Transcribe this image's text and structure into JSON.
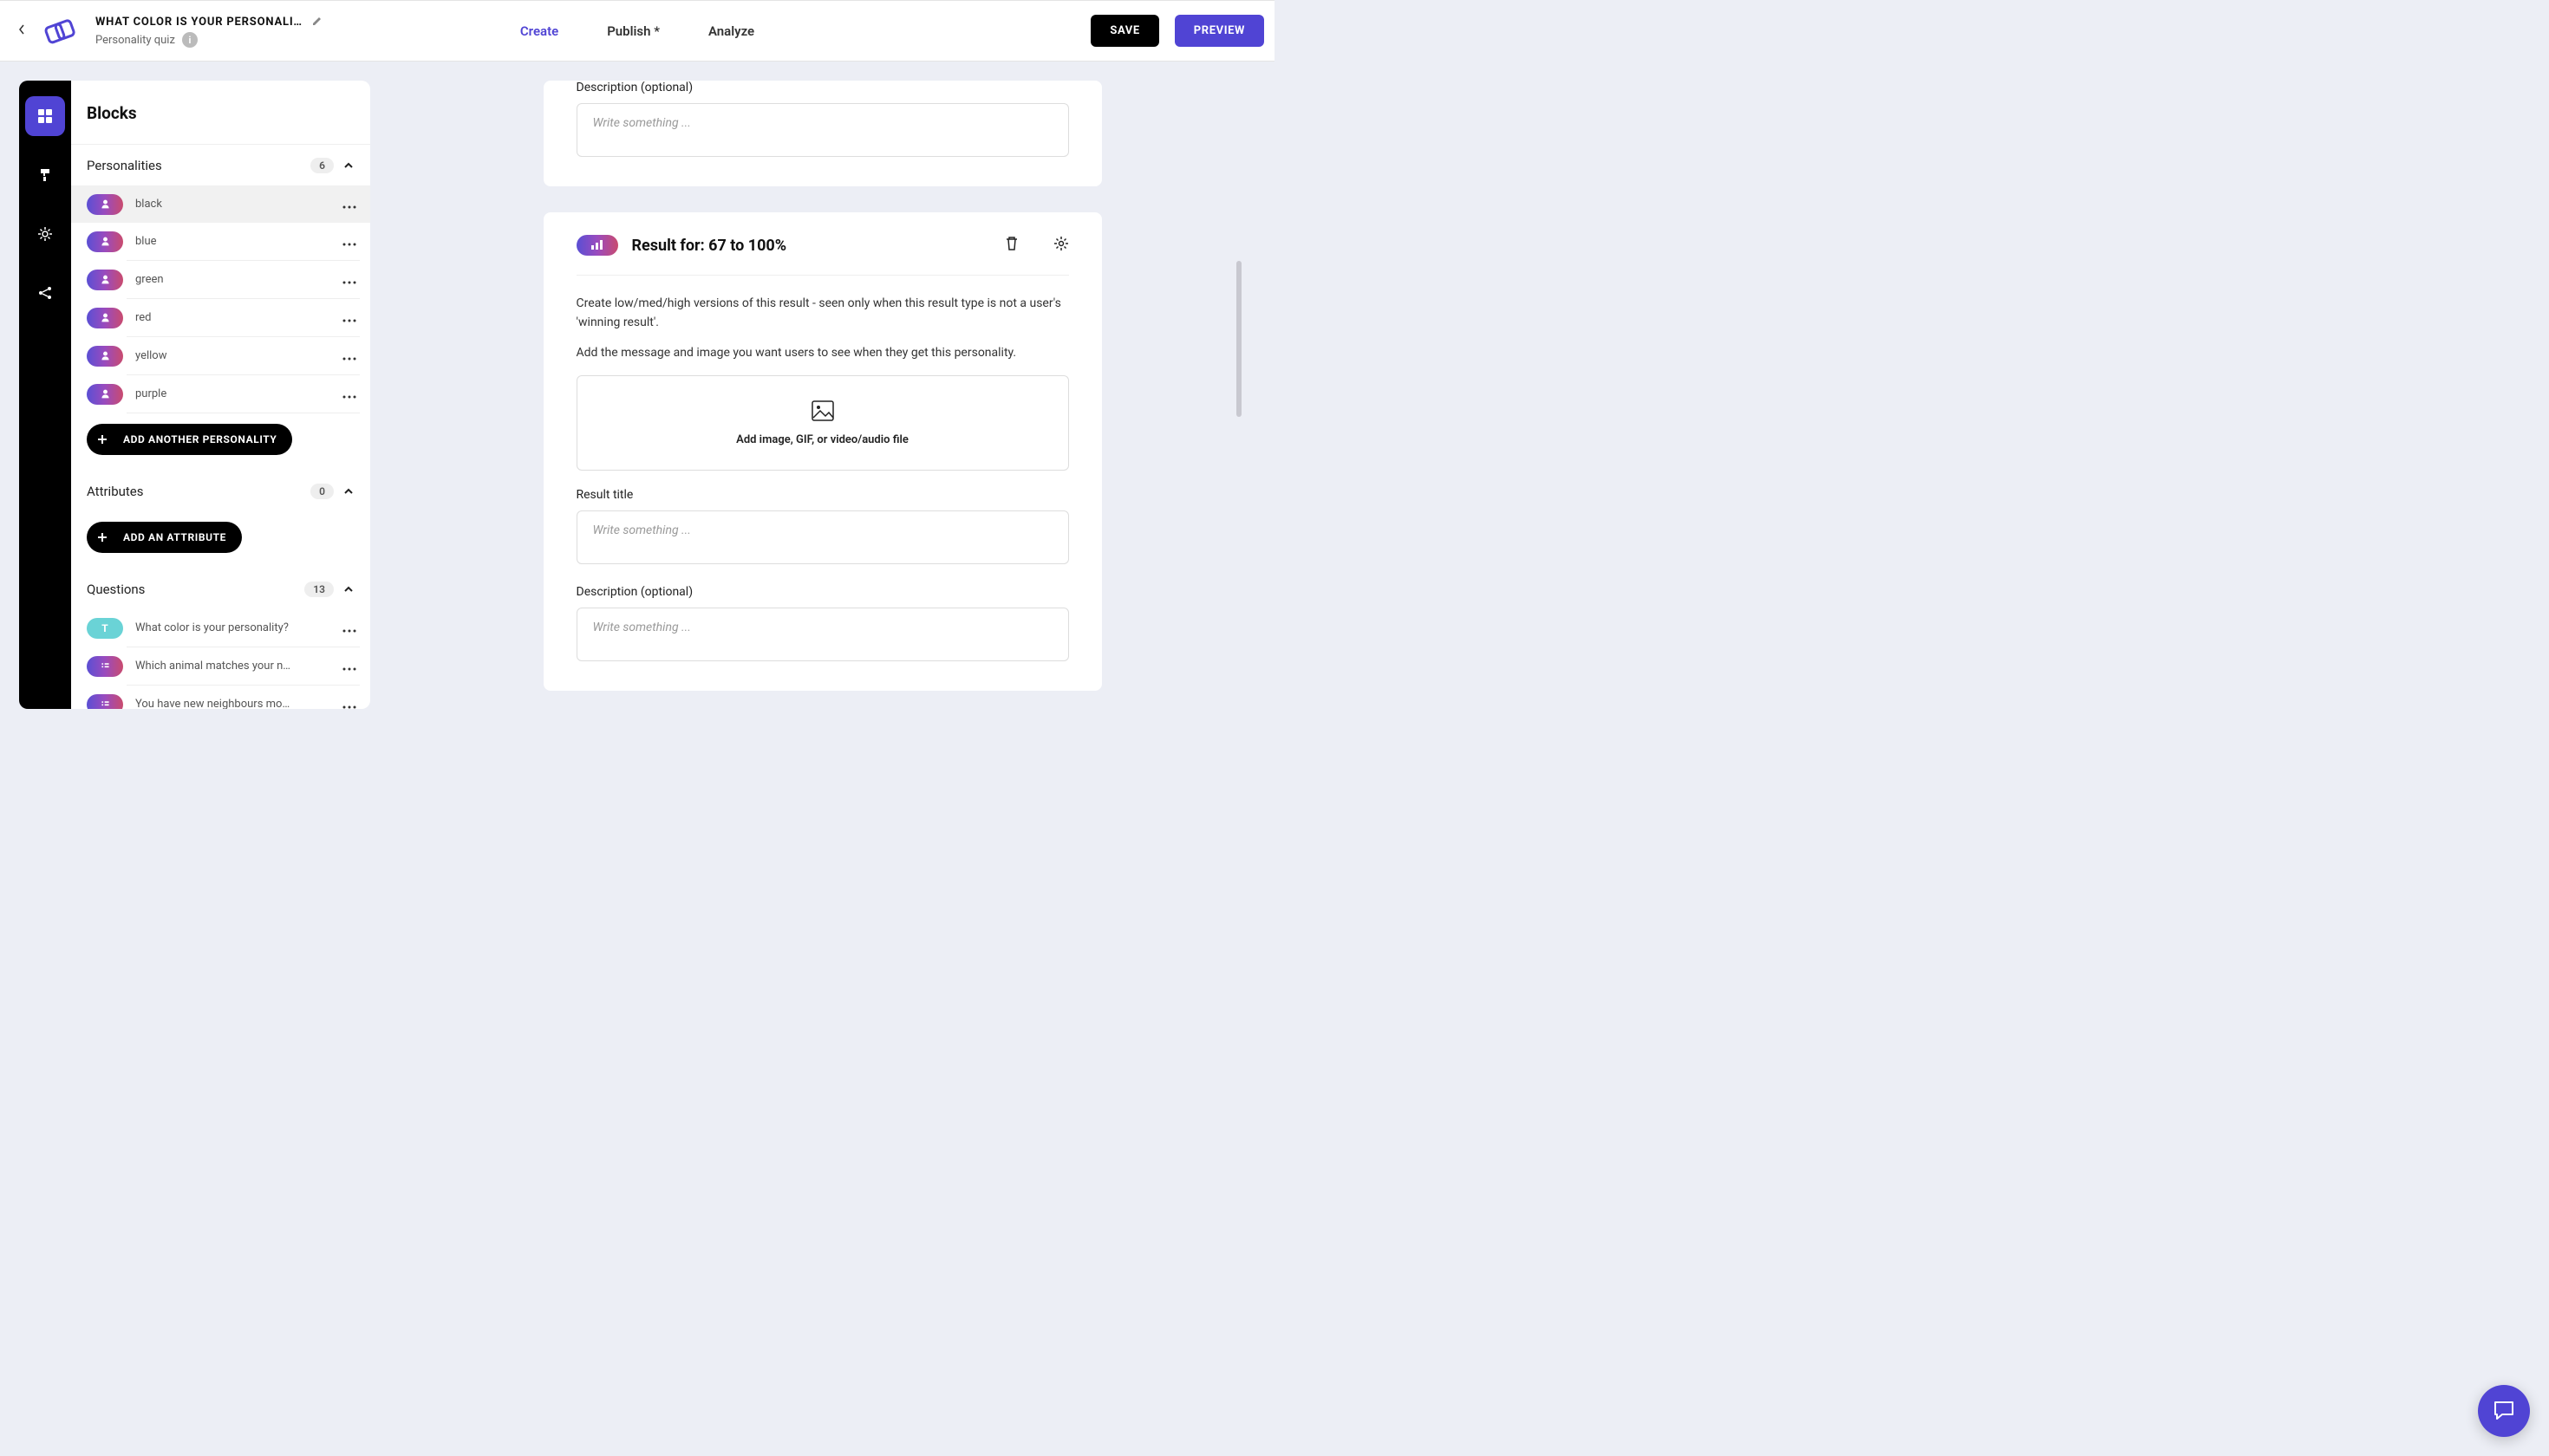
{
  "header": {
    "title": "WHAT COLOR IS YOUR PERSONALI…",
    "subtitle": "Personality quiz",
    "nav": {
      "create": "Create",
      "publish": "Publish *",
      "analyze": "Analyze"
    },
    "save": "SAVE",
    "preview": "PREVIEW"
  },
  "sidebar": {
    "panel_title": "Blocks",
    "sections": {
      "personalities": {
        "label": "Personalities",
        "count": "6"
      },
      "attributes": {
        "label": "Attributes",
        "count": "0"
      },
      "questions": {
        "label": "Questions",
        "count": "13"
      }
    },
    "personalities": [
      {
        "label": "black"
      },
      {
        "label": "blue"
      },
      {
        "label": "green"
      },
      {
        "label": "red"
      },
      {
        "label": "yellow"
      },
      {
        "label": "purple"
      }
    ],
    "questions": [
      {
        "label": "What color is your personality?",
        "type": "T"
      },
      {
        "label": "Which animal matches your n…",
        "type": "list"
      },
      {
        "label": "You have new neighbours mo…",
        "type": "list"
      }
    ],
    "add_personality": "ADD ANOTHER PERSONALITY",
    "add_attribute": "ADD AN ATTRIBUTE"
  },
  "main": {
    "top_card": {
      "desc_label": "Description (optional)",
      "desc_placeholder": "Write something ..."
    },
    "result_card": {
      "title": "Result for: 67 to 100%",
      "info1": "Create low/med/high versions of this result - seen only when this result type is not a user's 'winning result'.",
      "info2": "Add the message and image you want users to see when they get this personality.",
      "image_drop": "Add image, GIF, or video/audio file",
      "result_title_label": "Result title",
      "result_title_placeholder": "Write something ...",
      "desc_label": "Description (optional)",
      "desc_placeholder": "Write something ..."
    }
  }
}
